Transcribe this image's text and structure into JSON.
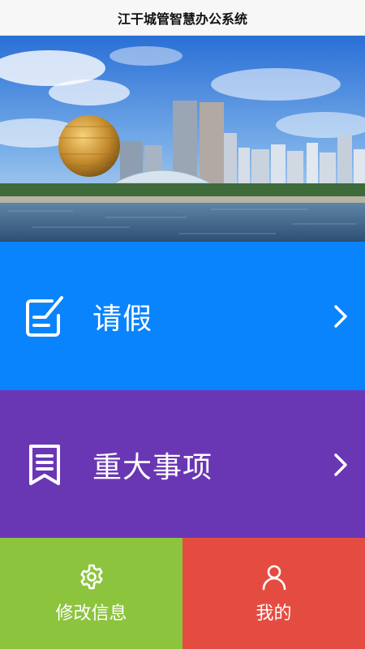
{
  "app": {
    "title": "江干城管智慧办公系统"
  },
  "banner": {
    "alt": ""
  },
  "tiles": [
    {
      "label": "请假",
      "color": "#0a84fd",
      "icon": "edit-note-icon"
    },
    {
      "label": "重大事项",
      "color": "#6a37b4",
      "icon": "document-list-icon"
    }
  ],
  "bottom_nav": [
    {
      "label": "修改信息",
      "color": "#8dc43e",
      "icon": "gear-icon"
    },
    {
      "label": "我的",
      "color": "#e54c41",
      "icon": "user-icon"
    }
  ]
}
